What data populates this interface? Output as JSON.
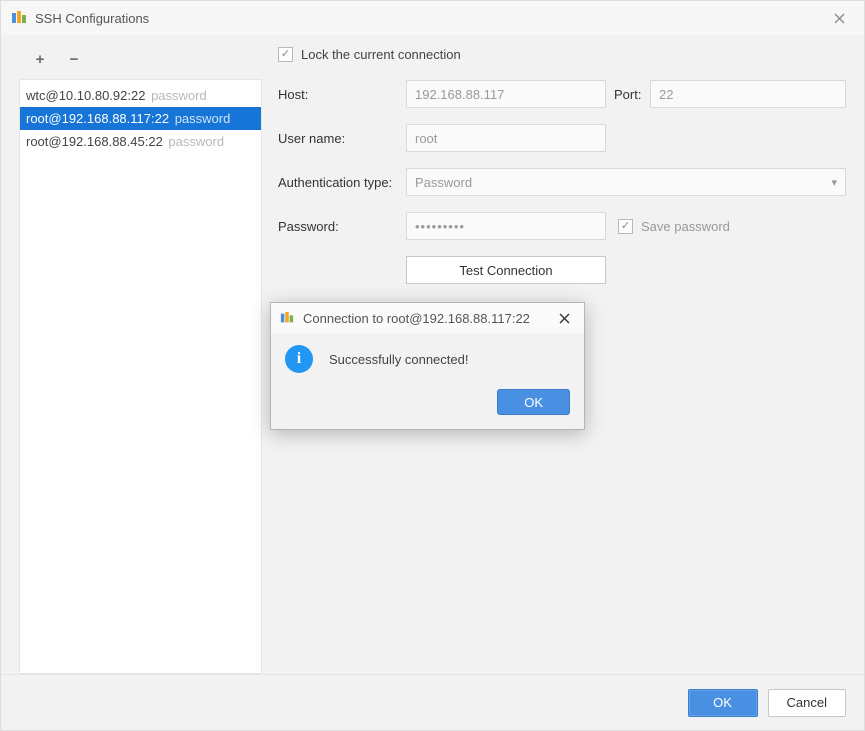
{
  "window": {
    "title": "SSH Configurations"
  },
  "lock": {
    "label": "Lock the current connection",
    "checked": true
  },
  "form": {
    "host_label": "Host:",
    "host_value": "192.168.88.117",
    "port_label": "Port:",
    "port_value": "22",
    "user_label": "User name:",
    "user_value": "root",
    "auth_label": "Authentication type:",
    "auth_value": "Password",
    "pass_label": "Password:",
    "pass_value": "•••••••••",
    "savepw_label": "Save password",
    "savepw_checked": true,
    "test_label": "Test Connection"
  },
  "configs": [
    {
      "name": "wtc@10.10.80.92:22",
      "hint": "password",
      "selected": false
    },
    {
      "name": "root@192.168.88.117:22",
      "hint": "password",
      "selected": true
    },
    {
      "name": "root@192.168.88.45:22",
      "hint": "password",
      "selected": false
    }
  ],
  "footer": {
    "ok": "OK",
    "cancel": "Cancel"
  },
  "modal": {
    "title": "Connection to root@192.168.88.117:22",
    "message": "Successfully connected!",
    "ok": "OK"
  }
}
